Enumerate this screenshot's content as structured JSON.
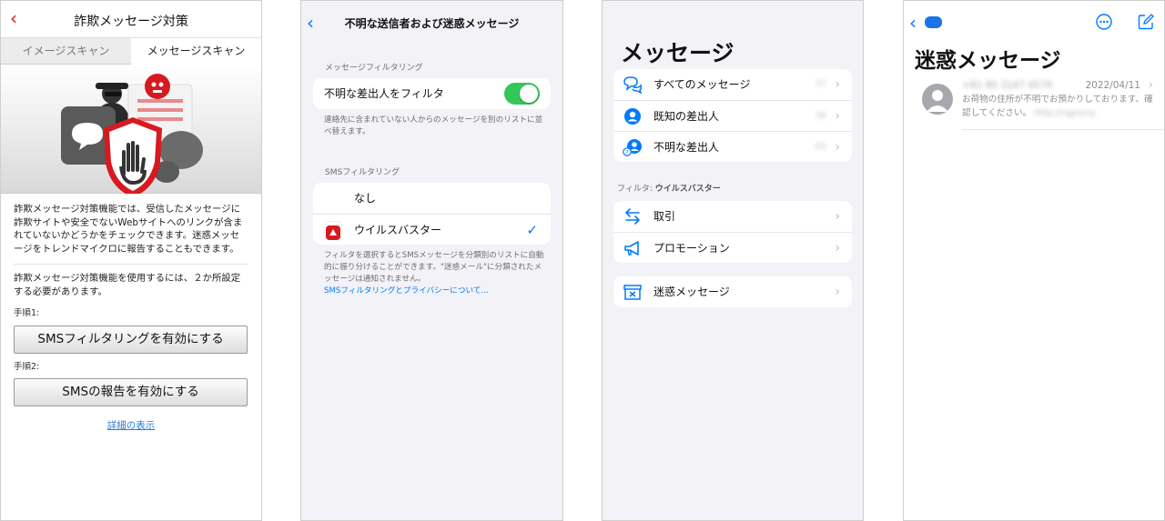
{
  "screen1": {
    "back_icon": "chevron-left-icon",
    "title": "詐欺メッセージ対策",
    "tabs": [
      "イメージスキャン",
      "メッセージスキャン"
    ],
    "description": "詐欺メッセージ対策機能では、受信したメッセージに詐欺サイトや安全でないWebサイトへのリンクが含まれていないかどうかをチェックできます。迷惑メッセージをトレンドマイクロに報告することもできます。",
    "setup_note": "詐欺メッセージ対策機能を使用するには、２か所設定する必要があります。",
    "step1_label": "手順1:",
    "step1_button": "SMSフィルタリングを有効にする",
    "step2_label": "手順2:",
    "step2_button": "SMSの報告を有効にする",
    "details_link": "詳細の表示",
    "accent_color": "#d71920"
  },
  "screen2": {
    "back_icon": "chevron-left-icon",
    "title": "不明な送信者および迷惑メッセージ",
    "section1_header": "メッセージフィルタリング",
    "filter_unknown_label": "不明な差出人をフィルタ",
    "filter_unknown_on": true,
    "section1_footer": "連絡先に含まれていない人からのメッセージを別のリストに並べ替えます。",
    "section2_header": "SMSフィルタリング",
    "option_none": "なし",
    "option_virusbuster": "ウイルスバスター",
    "selected_option": "ウイルスバスター",
    "section2_footer": "フィルタを選択するとSMSメッセージを分類別のリストに自動的に振り分けることができます。\"迷惑メール\"に分類されたメッセージは通知されません。",
    "privacy_link": "SMSフィルタリングとプライバシーについて...",
    "toggle_color": "#34c759",
    "link_color": "#007aff"
  },
  "screen3": {
    "title": "メッセージ",
    "rows": [
      {
        "label": "すべてのメッセージ",
        "count": "37",
        "icon": "chat-bubbles-icon"
      },
      {
        "label": "既知の差出人",
        "count": "36",
        "icon": "person-circle-icon"
      },
      {
        "label": "不明な差出人",
        "count": "45",
        "icon": "person-question-icon"
      }
    ],
    "filter_prefix": "フィルタ: ",
    "filter_name": "ウイルスバスター",
    "filter_rows": [
      {
        "label": "取引",
        "icon": "arrows-exchange-icon"
      },
      {
        "label": "プロモーション",
        "icon": "megaphone-icon"
      }
    ],
    "junk_row": {
      "label": "迷惑メッセージ",
      "icon": "junk-box-icon"
    }
  },
  "screen4": {
    "back_icon": "chevron-left-icon",
    "more_icon": "ellipsis-circle-icon",
    "compose_icon": "compose-icon",
    "title": "迷惑メッセージ",
    "message": {
      "sender": "+81 80 3147 4579",
      "date": "2022/04/11",
      "preview": "お荷物の住所が不明でお預かりしております、確認してください。",
      "url": "http://ngjnyvy"
    }
  }
}
